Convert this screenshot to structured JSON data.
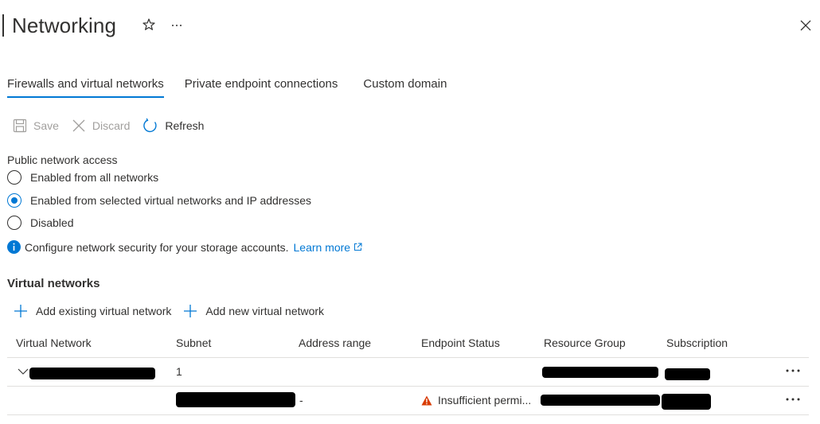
{
  "header": {
    "title": "Networking"
  },
  "tabs": [
    {
      "label": "Firewalls and virtual networks",
      "active": true
    },
    {
      "label": "Private endpoint connections",
      "active": false
    },
    {
      "label": "Custom domain",
      "active": false
    }
  ],
  "toolbar": {
    "save_label": "Save",
    "discard_label": "Discard",
    "refresh_label": "Refresh"
  },
  "public_access": {
    "label": "Public network access",
    "options": [
      {
        "label": "Enabled from all networks",
        "checked": false
      },
      {
        "label": "Enabled from selected virtual networks and IP addresses",
        "checked": true
      },
      {
        "label": "Disabled",
        "checked": false
      }
    ],
    "info_text": "Configure network security for your storage accounts.",
    "learn_more": "Learn more"
  },
  "virtual_networks": {
    "title": "Virtual networks",
    "add_existing_label": "Add existing virtual network",
    "add_new_label": "Add new virtual network",
    "columns": [
      "Virtual Network",
      "Subnet",
      "Address range",
      "Endpoint Status",
      "Resource Group",
      "Subscription"
    ],
    "rows": [
      {
        "subnet": "1",
        "address_range": "",
        "endpoint_status": ""
      },
      {
        "subnet": "",
        "address_range": "-",
        "endpoint_status": "Insufficient permi..."
      }
    ]
  },
  "colors": {
    "accent": "#0078d4",
    "warning": "#d83b01",
    "text": "#323130",
    "disabled": "#a19f9d"
  },
  "icons": [
    "star-icon",
    "more-icon",
    "close-icon",
    "save-icon",
    "discard-icon",
    "refresh-icon",
    "info-icon",
    "external-link-icon",
    "plus-icon",
    "chevron-down-icon",
    "warning-icon"
  ]
}
